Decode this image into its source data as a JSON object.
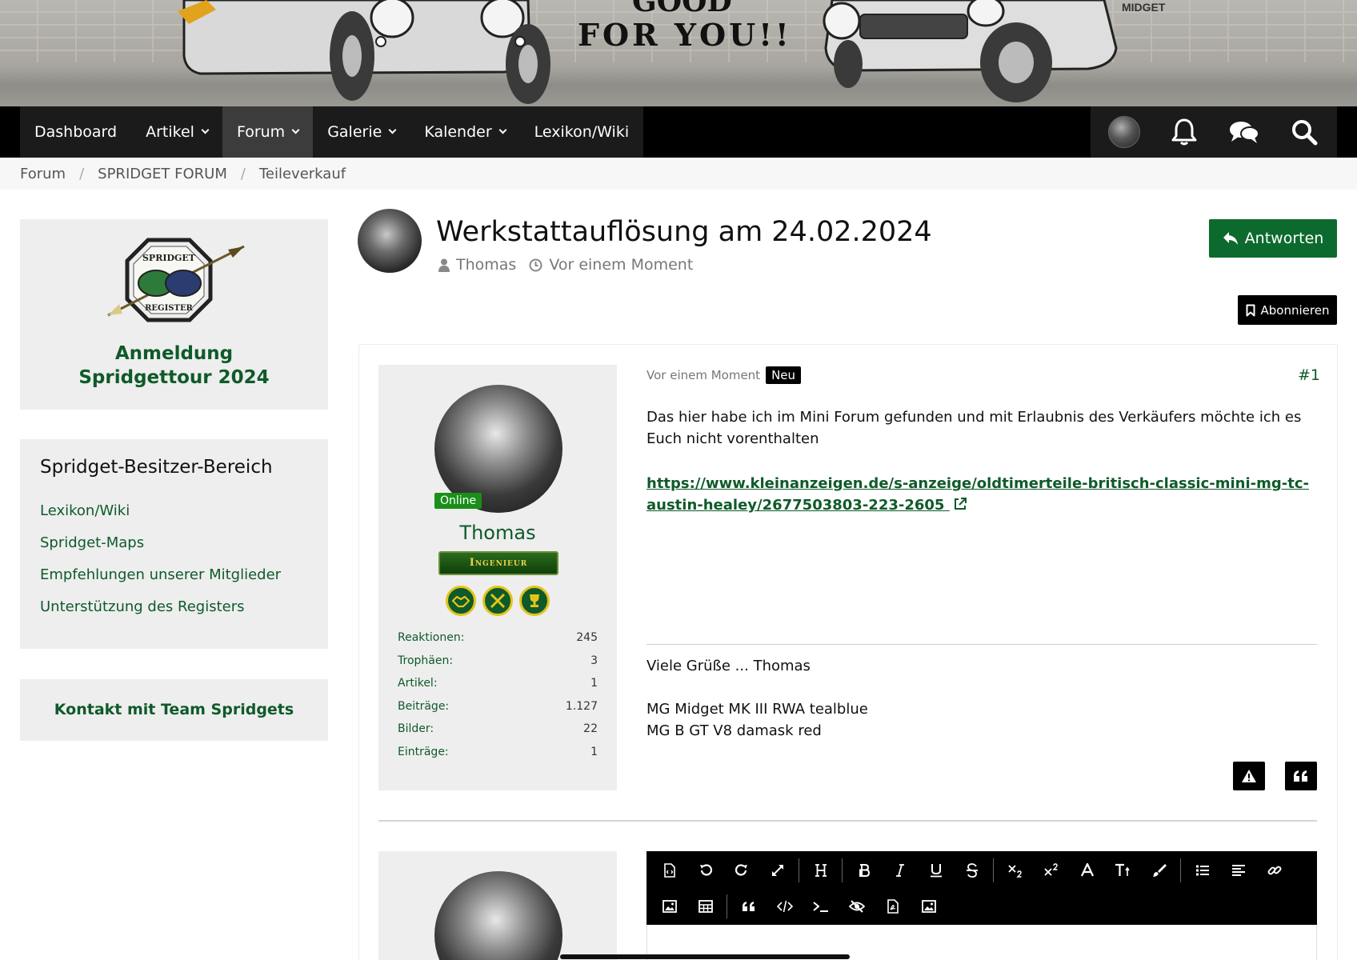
{
  "nav": {
    "items": [
      {
        "label": "Dashboard",
        "dropdown": false
      },
      {
        "label": "Artikel",
        "dropdown": true
      },
      {
        "label": "Forum",
        "dropdown": true,
        "active": true
      },
      {
        "label": "Galerie",
        "dropdown": true
      },
      {
        "label": "Kalender",
        "dropdown": true
      },
      {
        "label": "Lexikon/Wiki",
        "dropdown": false
      }
    ],
    "icons": [
      "avatar",
      "bell-icon",
      "comments-icon",
      "search-icon"
    ]
  },
  "breadcrumb": [
    "Forum",
    "SPRIDGET FORUM",
    "Teileverkauf"
  ],
  "sidebar": {
    "box1_title": "Anmeldung Spridgettour 2024",
    "logo_top_text": "SPRIDGET",
    "logo_bottom_text": "REGISTER",
    "box2_heading": "Spridget-Besitzer-Bereich",
    "box2_links": [
      "Lexikon/Wiki",
      "Spridget-Maps",
      "Empfehlungen unserer Mitglieder",
      "Unterstützung des Registers"
    ],
    "box3_link": "Kontakt mit Team Spridgets"
  },
  "thread": {
    "title": "Werkstattauflösung am 24.02.2024",
    "author": "Thomas",
    "time": "Vor einem Moment",
    "reply_label": "Antworten",
    "subscribe_label": "Abonnieren"
  },
  "post": {
    "time": "Vor einem Moment",
    "badge": "Neu",
    "number": "#1",
    "body": "Das hier habe ich im Mini Forum gefunden und mit Erlaubnis des Verkäufers möchte ich es Euch nicht vorenthalten",
    "link": "https://www.kleinanzeigen.de/s-anzeige/oldtimerteile-britisch-classic-mini-mg-tc-austin-healey/2677503803-223-2605",
    "signature": [
      "Viele Grüße ... Thomas",
      "",
      "MG Midget MK III RWA tealblue",
      "MG B GT V8 damask red"
    ]
  },
  "user": {
    "name": "Thomas",
    "status": "Online",
    "rank": "Ingenieur",
    "stats": [
      {
        "label": "Reaktionen:",
        "value": "245"
      },
      {
        "label": "Trophäen:",
        "value": "3"
      },
      {
        "label": "Artikel:",
        "value": "1"
      },
      {
        "label": "Beiträge:",
        "value": "1.127"
      },
      {
        "label": "Bilder:",
        "value": "22"
      },
      {
        "label": "Einträge:",
        "value": "1"
      }
    ]
  },
  "banner": {
    "slogan_line1": "GOOD",
    "slogan_line2": "FOR YOU!!",
    "badge_text": "MIDGET"
  },
  "colors": {
    "brand_green": "#0f5a2a",
    "reply_button": "#0d6a2e",
    "nav_bg": "#000000",
    "online": "#1a8f1a"
  }
}
